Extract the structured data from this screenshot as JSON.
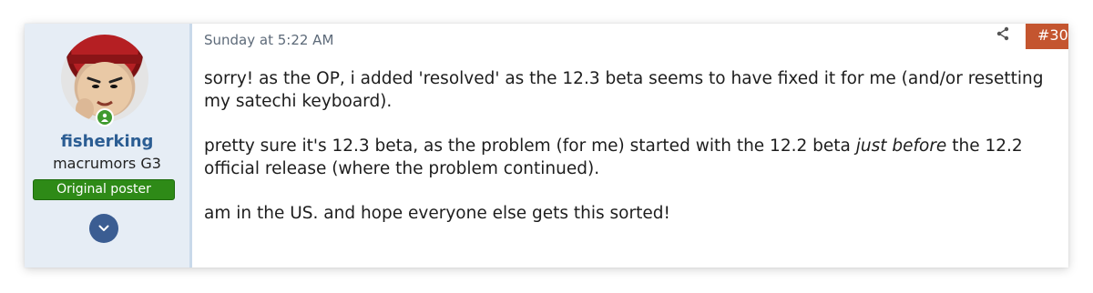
{
  "user": {
    "name": "fisherking",
    "title": "macrumors G3",
    "badge": "Original poster"
  },
  "post": {
    "timestamp": "Sunday at 5:22 AM",
    "number": "#30",
    "paragraphs": [
      "sorry! as the OP, i added 'resolved' as the 12.3 beta seems to have fixed it for me (and/or resetting my satechi keyboard).",
      {
        "before": "pretty sure it's 12.3 beta, as the problem (for me) started with the 12.2 beta ",
        "emphasis": "just before",
        "after": " the 12.2 official release (where the problem continued)."
      },
      "am in the US. and hope everyone else gets this sorted!"
    ]
  },
  "icons": {
    "share": "share-icon",
    "online": "online-status-icon",
    "expand": "chevron-down-icon"
  },
  "colors": {
    "sidebar_bg": "#e6edf5",
    "username": "#2b5d93",
    "badge_bg": "#2e8a17",
    "post_number_bg": "#c4552f",
    "expand_button": "#3b5d92",
    "online": "#3f9a2e"
  }
}
